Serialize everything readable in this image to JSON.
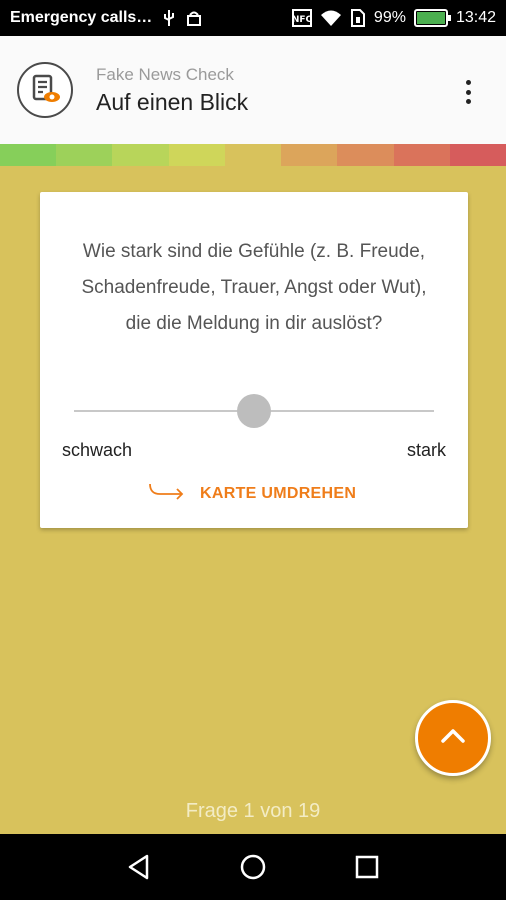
{
  "status_bar": {
    "carrier": "Emergency calls…",
    "nfc": "NFC",
    "battery": "99%",
    "battery_level": 0.99,
    "time": "13:42"
  },
  "app_bar": {
    "subtitle": "Fake News Check",
    "title": "Auf einen Blick",
    "logo_icon": "document-eye-icon",
    "menu_icon": "more-vert-icon"
  },
  "progress_strip": {
    "colors": [
      "#86cf5a",
      "#9dd15a",
      "#b8d55a",
      "#cfd65a",
      "#d8c25c",
      "#dca55b",
      "#dc8d5b",
      "#da735b",
      "#d65c5c"
    ]
  },
  "card": {
    "question": "Wie stark sind die Gefühle (z. B. Freude, Schadenfreude, Trauer, Angst oder Wut), die die Meldung in dir auslöst?",
    "slider_value": 0.5,
    "min_label": "schwach",
    "max_label": "stark",
    "flip_label": "KARTE UMDREHEN",
    "flip_icon": "arrow-turn-right-icon"
  },
  "fab": {
    "icon": "chevron-up-icon"
  },
  "counter": "Frage 1 von 19",
  "nav": {
    "back_icon": "back-triangle-icon",
    "home_icon": "home-circle-icon",
    "recent_icon": "recent-square-icon"
  },
  "colors": {
    "background": "#d8c25c",
    "accent": "#ef7d00"
  }
}
